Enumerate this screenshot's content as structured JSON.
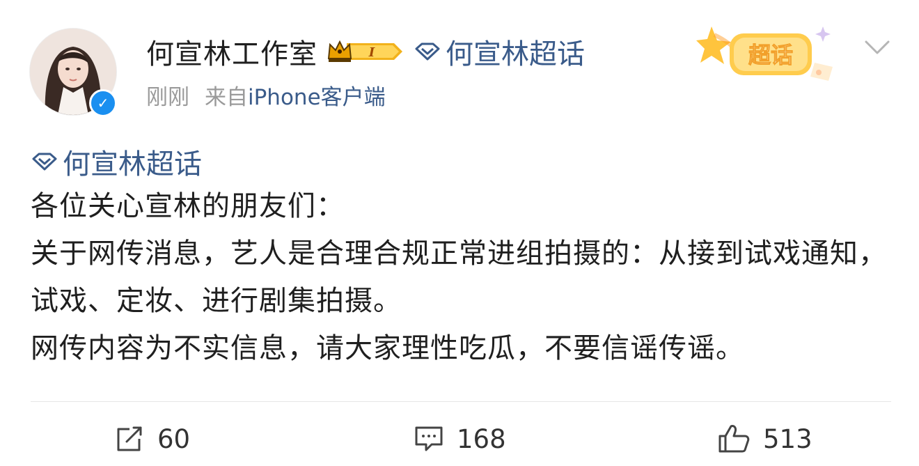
{
  "author": {
    "name": "何宣林工作室",
    "vip_level": "I",
    "verified_icon": "verified-icon"
  },
  "header": {
    "topic_link": "何宣林超话",
    "time": "刚刚",
    "source": "来自",
    "device": "iPhone客户端",
    "sticker_text": "超话"
  },
  "post": {
    "topic_tag": "何宣林超话",
    "paragraphs": [
      "各位关心宣林的朋友们：",
      "关于网传消息，艺人是合理合规正常进组拍摄的：从接到试戏通知，试戏、定妆、进行剧集拍摄。",
      "网传内容为不实信息，请大家理性吃瓜，不要信谣传谣。"
    ]
  },
  "actions": {
    "repost_count": "60",
    "comment_count": "168",
    "like_count": "513"
  },
  "colors": {
    "link": "#3a5b8a",
    "verified": "#1a8ff0",
    "meta": "#9a9a9a"
  }
}
